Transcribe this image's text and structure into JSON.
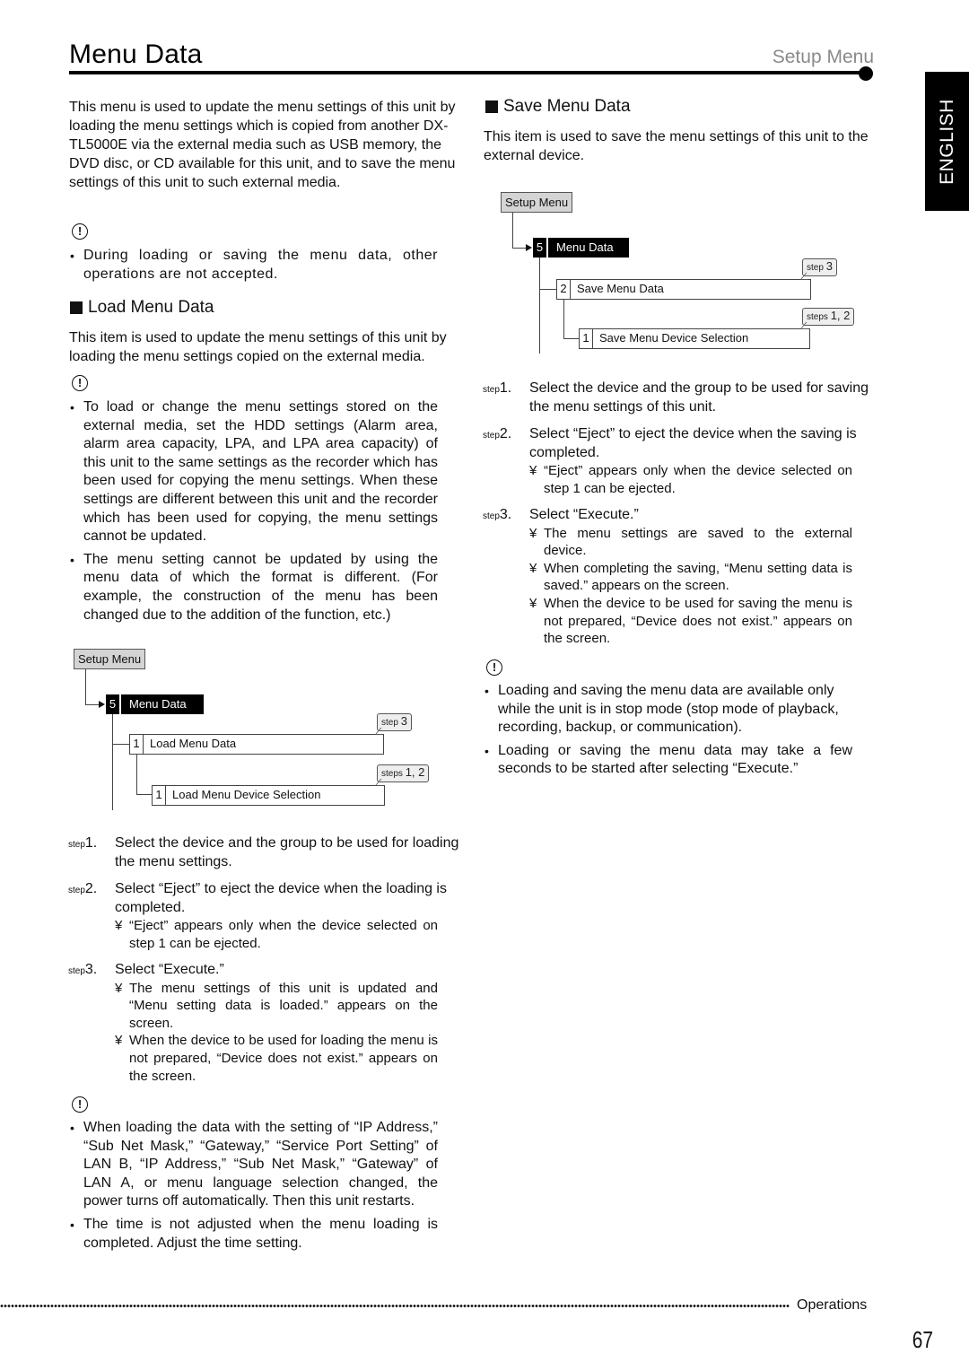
{
  "header": {
    "title": "Menu Data",
    "section": "Setup Menu"
  },
  "language_tab": "ENGLISH",
  "intro": "This menu is used to update the menu settings of this unit by loading the menu settings which is copied from another DX-TL5000E via the external media such as USB memory, the DVD disc, or CD available for this unit, and to save the menu settings of this unit to such external media.",
  "caution_icon": "!",
  "intro_caution": [
    "During loading or saving the menu data, other operations are not accepted."
  ],
  "load": {
    "heading": "Load Menu Data",
    "description": "This item is used to update the menu settings of this unit by loading the menu settings copied on the external media.",
    "cautions": [
      "To load or change the menu settings stored on the external media, set the HDD settings (Alarm area, alarm area capacity, LPA, and LPA area capacity) of this unit to the same settings as the recorder which has been used for copying the menu settings. When these settings are different between this unit and the recorder which has been used for copying, the menu settings cannot be updated.",
      "The menu setting cannot be updated by using the menu data of which the format is different. (For example, the construction of the menu has been changed due to the addition of the function, etc.)"
    ],
    "diagram": {
      "root": "Setup Menu",
      "menu_number": "5",
      "menu_label": "Menu Data",
      "item_number": "1",
      "item_label": "Load Menu Data",
      "subitem_number": "1",
      "subitem_label": "Load Menu Device Selection",
      "callout_item_prefix": "step",
      "callout_item_value": "3",
      "callout_subitem_prefix": "steps",
      "callout_subitem_value": "1, 2"
    },
    "steps": [
      {
        "prefix": "step",
        "num": "1.",
        "text": "Select the device and the group to be used for loading the menu settings.",
        "notes": []
      },
      {
        "prefix": "step",
        "num": "2.",
        "text": "Select “Eject” to eject the device when the loading is completed.",
        "notes": [
          "“Eject” appears only when the device selected on step 1 can be ejected."
        ]
      },
      {
        "prefix": "step",
        "num": "3.",
        "text": "Select “Execute.”",
        "notes": [
          "The menu settings of this unit is updated and “Menu setting data is loaded.” appears on the screen.",
          "When the device to be used for loading the menu is not prepared, “Device does not exist.” appears on the screen."
        ]
      }
    ],
    "final_cautions": [
      "When loading the data with the setting of “IP Address,” “Sub Net Mask,” “Gateway,” “Service Port Setting” of LAN B, “IP Address,” “Sub Net Mask,” “Gateway” of LAN A, or menu language selection changed, the power turns off automatically. Then this unit restarts.",
      "The time is not adjusted when the menu loading is completed. Adjust the time setting."
    ]
  },
  "save": {
    "heading": "Save Menu Data",
    "description": "This item is used to save the menu settings of this unit to the external device.",
    "diagram": {
      "root": "Setup Menu",
      "menu_number": "5",
      "menu_label": "Menu Data",
      "item_number": "2",
      "item_label": "Save Menu Data",
      "subitem_number": "1",
      "subitem_label": "Save Menu Device Selection",
      "callout_item_prefix": "step",
      "callout_item_value": "3",
      "callout_subitem_prefix": "steps",
      "callout_subitem_value": "1, 2"
    },
    "steps": [
      {
        "prefix": "step",
        "num": "1.",
        "text": "Select the device and the group to be used for saving the menu settings of this unit.",
        "notes": []
      },
      {
        "prefix": "step",
        "num": "2.",
        "text": "Select “Eject” to eject the device when the saving is completed.",
        "notes": [
          "“Eject” appears only when the device selected on step 1 can be ejected."
        ]
      },
      {
        "prefix": "step",
        "num": "3.",
        "text": "Select “Execute.”",
        "notes": [
          "The menu settings are saved to the external device.",
          "When completing the saving, “Menu setting data is saved.” appears on the screen.",
          "When the device to be used for saving the menu is not prepared, “Device does not exist.” appears on the screen."
        ]
      }
    ],
    "final_cautions": [
      "Loading and saving the menu data are available only while the unit is in stop mode (stop mode of playback, recording, backup, or communication).",
      "Loading or saving the menu data may take a few seconds to be started after selecting “Execute.”"
    ]
  },
  "note_marker": "¥",
  "footer": {
    "section": "Operations",
    "page_number": "67"
  }
}
